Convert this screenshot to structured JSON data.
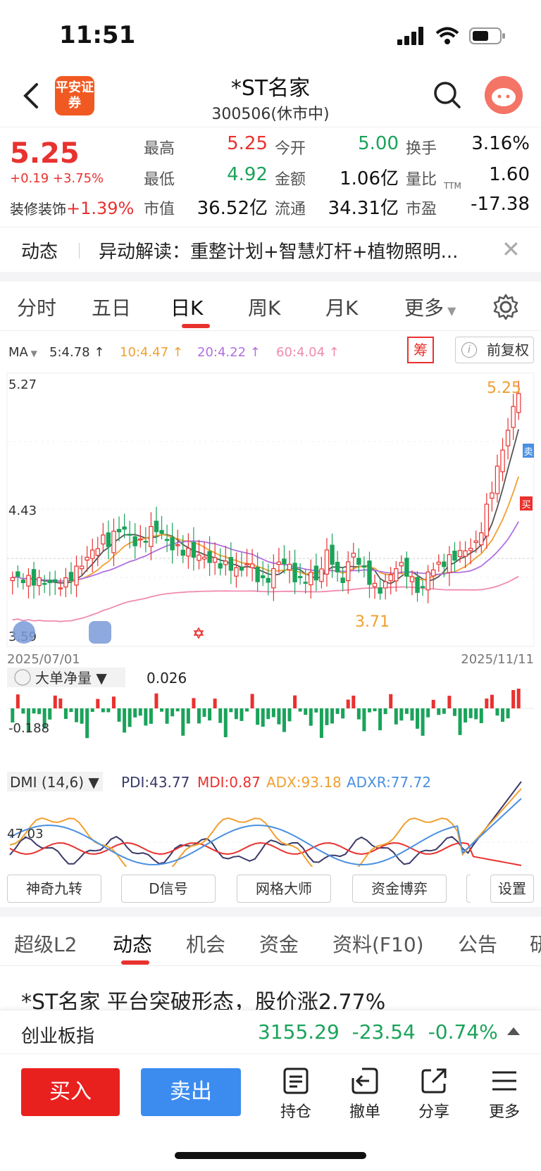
{
  "status": {
    "time": "11:51"
  },
  "header": {
    "logo_text": "平安证券",
    "title": "*ST名家",
    "subtitle": "300506(休市中)"
  },
  "quote": {
    "price": "5.25",
    "change": "+0.19 +3.75%",
    "sector_name": "装修装饰",
    "sector_change": "+1.39%",
    "fields": [
      {
        "label": "最高",
        "value": "5.25",
        "color": "red"
      },
      {
        "label": "今开",
        "value": "5.00",
        "color": "green"
      },
      {
        "label": "换手",
        "value": "3.16%",
        "color": "black"
      },
      {
        "label": "最低",
        "value": "4.92",
        "color": "green"
      },
      {
        "label": "金额",
        "value": "1.06亿",
        "color": "black"
      },
      {
        "label": "量比",
        "value": "1.60",
        "color": "black"
      },
      {
        "label": "市值",
        "value": "36.52亿",
        "color": "black"
      },
      {
        "label": "流通",
        "value": "34.31亿",
        "color": "black"
      },
      {
        "label": "市盈",
        "value": "-17.38",
        "color": "black"
      }
    ],
    "pe_superscript": "TTM"
  },
  "news": {
    "tag": "动态",
    "text": "异动解读：重整计划+智慧灯杆+植物照明..."
  },
  "period_tabs": [
    "分时",
    "五日",
    "日K",
    "周K",
    "月K",
    "更多"
  ],
  "period_active": 2,
  "ma": {
    "label": "MA",
    "items": [
      {
        "text": "5:4.78",
        "color": "#333333"
      },
      {
        "text": "10:4.47",
        "color": "#f0a030"
      },
      {
        "text": "20:4.22",
        "color": "#b070e0"
      },
      {
        "text": "60:4.04",
        "color": "#f08ab0"
      }
    ],
    "chip_label": "筹",
    "adjust_label": "前复权"
  },
  "kline": {
    "y_top": "5.27",
    "y_mid": "4.43",
    "y_bottom": "3.59",
    "date_start": "2025/07/01",
    "date_end": "2025/11/11",
    "high_marker": "5.25",
    "low_marker": "3.71",
    "sell_marker": "卖",
    "buy_marker": "买",
    "colors": {
      "up": "#e8322f",
      "down": "#1aa35a",
      "ma5": "#555555",
      "ma10": "#f0a030",
      "ma20": "#b070e0",
      "ma60": "#f08ab0"
    }
  },
  "flow": {
    "label": "大单净量",
    "value": "0.026",
    "axis_label": "-0.188"
  },
  "dmi": {
    "label": "DMI (14,6)",
    "pdi": "PDI:43.77",
    "mdi": "MDI:0.87",
    "adx": "ADX:93.18",
    "adxr": "ADXR:77.72",
    "axis_label": "47.03",
    "colors": {
      "pdi": "#3a3a6a",
      "mdi": "#e8322f",
      "adx": "#f0a030",
      "adxr": "#4a90e2"
    }
  },
  "tools": [
    "神奇九转",
    "D信号",
    "网格大师",
    "资金博弈",
    "设置"
  ],
  "info_tabs": [
    "超级L2",
    "动态",
    "机会",
    "资金",
    "资料(F10)",
    "公告",
    "研"
  ],
  "info_active": 1,
  "headline": "*ST名家 平台突破形态，股价涨2.77%",
  "index": {
    "name": "创业板指",
    "value": "3155.29",
    "change": "-23.54",
    "pct": "-0.74%"
  },
  "trade": {
    "buy": "买入",
    "sell": "卖出",
    "actions": [
      "持仓",
      "撤单",
      "分享",
      "更多"
    ]
  }
}
